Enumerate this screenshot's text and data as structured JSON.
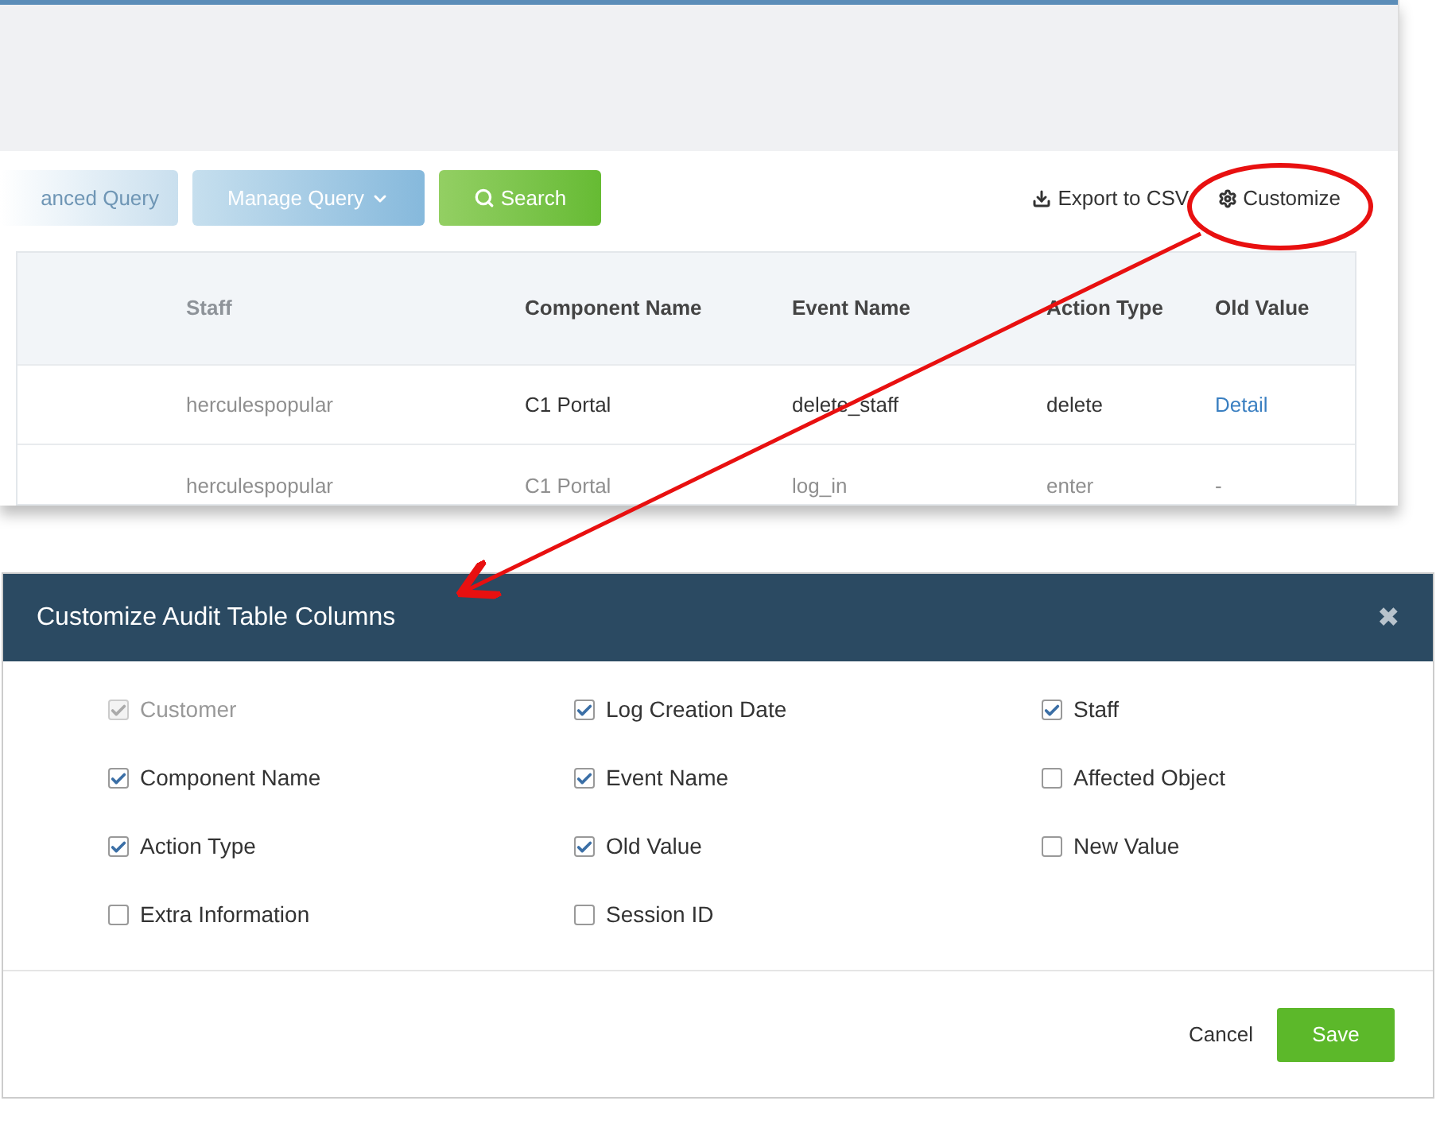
{
  "toolbar": {
    "buttons": [
      {
        "label": "anced Query",
        "kind": "faded"
      },
      {
        "label": "Manage Query",
        "kind": "dropdown"
      },
      {
        "label": "Search",
        "kind": "search"
      }
    ],
    "links": [
      {
        "label": "Export to CSV",
        "kind": "export"
      },
      {
        "label": "Customize",
        "kind": "customize"
      }
    ]
  },
  "table": {
    "columns": [
      "",
      "Staff",
      "Component Name",
      "Event Name",
      "Action Type",
      "Old Value"
    ],
    "rows": [
      {
        "cells": [
          "",
          "herculespopular",
          "C1 Portal",
          "delete_staff",
          "delete",
          "Detail"
        ]
      },
      {
        "cells": [
          "",
          "herculespopular",
          "C1 Portal",
          "log_in",
          "enter",
          "-"
        ]
      }
    ]
  },
  "dialog": {
    "title": "Customize Audit Table Columns",
    "close": "✖",
    "options": [
      {
        "label": "Customer",
        "checked": true,
        "disabled": true
      },
      {
        "label": "Log Creation Date",
        "checked": true,
        "disabled": false
      },
      {
        "label": "Staff",
        "checked": true,
        "disabled": false
      },
      {
        "label": "Component Name",
        "checked": true,
        "disabled": false
      },
      {
        "label": "Event Name",
        "checked": true,
        "disabled": false
      },
      {
        "label": "Affected Object",
        "checked": false,
        "disabled": false
      },
      {
        "label": "Action Type",
        "checked": true,
        "disabled": false
      },
      {
        "label": "Old Value",
        "checked": true,
        "disabled": false
      },
      {
        "label": "New Value",
        "checked": false,
        "disabled": false
      },
      {
        "label": "Extra Information",
        "checked": false,
        "disabled": false
      },
      {
        "label": "Session ID",
        "checked": false,
        "disabled": false
      }
    ],
    "buttons": [
      {
        "label": "Cancel",
        "kind": "link"
      },
      {
        "label": "Save",
        "kind": "primary"
      }
    ]
  }
}
